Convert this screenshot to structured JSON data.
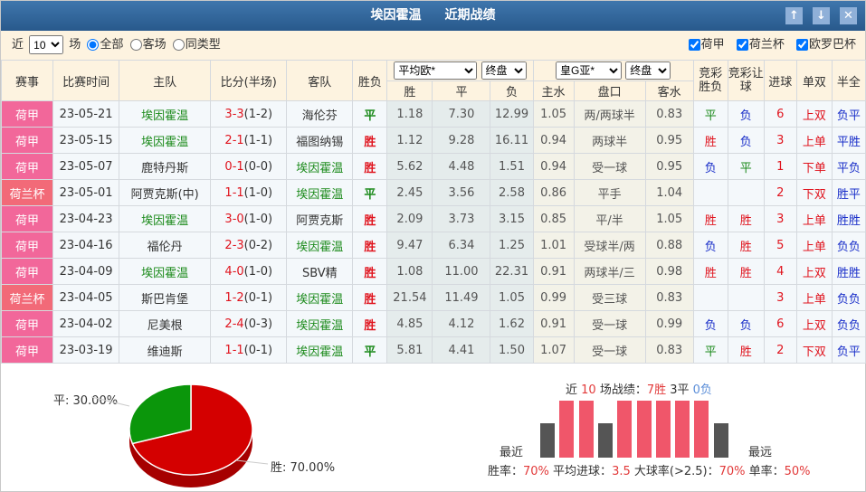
{
  "title": {
    "team": "埃因霍温",
    "section": "近期战绩"
  },
  "buttons": {
    "up": "↑",
    "down": "↓",
    "close": "✕"
  },
  "filter": {
    "prefix": "近",
    "count": "10",
    "suffix": "场",
    "radios": [
      {
        "label": "全部",
        "checked": true
      },
      {
        "label": "客场",
        "checked": false
      },
      {
        "label": "同类型",
        "checked": false
      }
    ],
    "leagues": [
      {
        "label": "荷甲",
        "checked": true
      },
      {
        "label": "荷兰杯",
        "checked": true
      },
      {
        "label": "欧罗巴杯",
        "checked": true
      }
    ]
  },
  "headers": {
    "league": "赛事",
    "date": "比赛时间",
    "home": "主队",
    "score": "比分(半场)",
    "away": "客队",
    "result": "胜负",
    "eu_company": "平均欧*",
    "eu_type": "终盘",
    "asia_company": "皇G亚*",
    "asia_type": "终盘",
    "win": "胜",
    "draw": "平",
    "lose": "负",
    "home_water": "主水",
    "handicap": "盘口",
    "away_water": "客水",
    "jc_result": "竞彩胜负",
    "jc_handicap": "竞彩让球",
    "goals": "进球",
    "odd_even": "单双",
    "half_full": "半全"
  },
  "rows": [
    {
      "league": "荷甲",
      "date": "23-05-21",
      "home": "埃因霍温",
      "score": "3-3",
      "half": "(1-2)",
      "away": "海伦芬",
      "result": "平",
      "w": "1.18",
      "d": "7.30",
      "l": "12.99",
      "hw": "1.05",
      "hc": "两/两球半",
      "aw": "0.83",
      "jc": "平",
      "jcr": "负",
      "goals": "6",
      "oe": "上双",
      "hf": "负平"
    },
    {
      "league": "荷甲",
      "date": "23-05-15",
      "home": "埃因霍温",
      "score": "2-1",
      "half": "(1-1)",
      "away": "福图纳锡",
      "result": "胜",
      "w": "1.12",
      "d": "9.28",
      "l": "16.11",
      "hw": "0.94",
      "hc": "两球半",
      "aw": "0.95",
      "jc": "胜",
      "jcr": "负",
      "goals": "3",
      "oe": "上单",
      "hf": "平胜"
    },
    {
      "league": "荷甲",
      "date": "23-05-07",
      "home": "鹿特丹斯",
      "score": "0-1",
      "half": "(0-0)",
      "away": "埃因霍温",
      "result": "胜",
      "w": "5.62",
      "d": "4.48",
      "l": "1.51",
      "hw": "0.94",
      "hc": "受一球",
      "aw": "0.95",
      "jc": "负",
      "jcr": "平",
      "goals": "1",
      "oe": "下单",
      "hf": "平负"
    },
    {
      "league": "荷兰杯",
      "date": "23-05-01",
      "home": "阿贾克斯(中)",
      "score": "1-1",
      "half": "(1-0)",
      "away": "埃因霍温",
      "result": "平",
      "w": "2.45",
      "d": "3.56",
      "l": "2.58",
      "hw": "0.86",
      "hc": "平手",
      "aw": "1.04",
      "jc": "",
      "jcr": "",
      "goals": "2",
      "oe": "下双",
      "hf": "胜平"
    },
    {
      "league": "荷甲",
      "date": "23-04-23",
      "home": "埃因霍温",
      "score": "3-0",
      "half": "(1-0)",
      "away": "阿贾克斯",
      "result": "胜",
      "w": "2.09",
      "d": "3.73",
      "l": "3.15",
      "hw": "0.85",
      "hc": "平/半",
      "aw": "1.05",
      "jc": "胜",
      "jcr": "胜",
      "goals": "3",
      "oe": "上单",
      "hf": "胜胜"
    },
    {
      "league": "荷甲",
      "date": "23-04-16",
      "home": "福伦丹",
      "score": "2-3",
      "half": "(0-2)",
      "away": "埃因霍温",
      "result": "胜",
      "w": "9.47",
      "d": "6.34",
      "l": "1.25",
      "hw": "1.01",
      "hc": "受球半/两",
      "aw": "0.88",
      "jc": "负",
      "jcr": "胜",
      "goals": "5",
      "oe": "上单",
      "hf": "负负"
    },
    {
      "league": "荷甲",
      "date": "23-04-09",
      "home": "埃因霍温",
      "score": "4-0",
      "half": "(1-0)",
      "away": "SBV精",
      "result": "胜",
      "w": "1.08",
      "d": "11.00",
      "l": "22.31",
      "hw": "0.91",
      "hc": "两球半/三",
      "aw": "0.98",
      "jc": "胜",
      "jcr": "胜",
      "goals": "4",
      "oe": "上双",
      "hf": "胜胜"
    },
    {
      "league": "荷兰杯",
      "date": "23-04-05",
      "home": "斯巴肯堡",
      "score": "1-2",
      "half": "(0-1)",
      "away": "埃因霍温",
      "result": "胜",
      "w": "21.54",
      "d": "11.49",
      "l": "1.05",
      "hw": "0.99",
      "hc": "受三球",
      "aw": "0.83",
      "jc": "",
      "jcr": "",
      "goals": "3",
      "oe": "上单",
      "hf": "负负"
    },
    {
      "league": "荷甲",
      "date": "23-04-02",
      "home": "尼美根",
      "score": "2-4",
      "half": "(0-3)",
      "away": "埃因霍温",
      "result": "胜",
      "w": "4.85",
      "d": "4.12",
      "l": "1.62",
      "hw": "0.91",
      "hc": "受一球",
      "aw": "0.99",
      "jc": "负",
      "jcr": "负",
      "goals": "6",
      "oe": "上双",
      "hf": "负负"
    },
    {
      "league": "荷甲",
      "date": "23-03-19",
      "home": "维迪斯",
      "score": "1-1",
      "half": "(0-1)",
      "away": "埃因霍温",
      "result": "平",
      "w": "5.81",
      "d": "4.41",
      "l": "1.50",
      "hw": "1.07",
      "hc": "受一球",
      "aw": "0.83",
      "jc": "平",
      "jcr": "胜",
      "goals": "2",
      "oe": "下双",
      "hf": "负平"
    }
  ],
  "chart_data": [
    {
      "type": "pie",
      "slices": [
        {
          "label": "胜: 70.00%",
          "name": "胜",
          "value": 70,
          "color": "#d40000"
        },
        {
          "label": "平: 30.00%",
          "name": "平",
          "value": 30,
          "color": "#0b960b"
        }
      ]
    },
    {
      "type": "bar",
      "title": "近10场战绩",
      "categories": [
        "1",
        "2",
        "3",
        "4",
        "5",
        "6",
        "7",
        "8",
        "9",
        "10"
      ],
      "values": [
        "平",
        "胜",
        "胜",
        "平",
        "胜",
        "胜",
        "胜",
        "胜",
        "胜",
        "平"
      ],
      "left_label": "最近",
      "right_label": "最远"
    }
  ],
  "summary": {
    "pre": "近 ",
    "n": "10",
    "mid": " 场战绩：",
    "w": "7胜",
    "d": " 3平 ",
    "l": "0负"
  },
  "rates": {
    "win_label": "胜率：",
    "win": "70%",
    "avg_label": " 平均进球：",
    "avg": "3.5",
    "big_label": " 大球率(>2.5)：",
    "big": "70%",
    "odd_label": " 单率：",
    "odd": "50%"
  },
  "colors": {
    "win": "#f0566a",
    "draw": "#555555"
  }
}
